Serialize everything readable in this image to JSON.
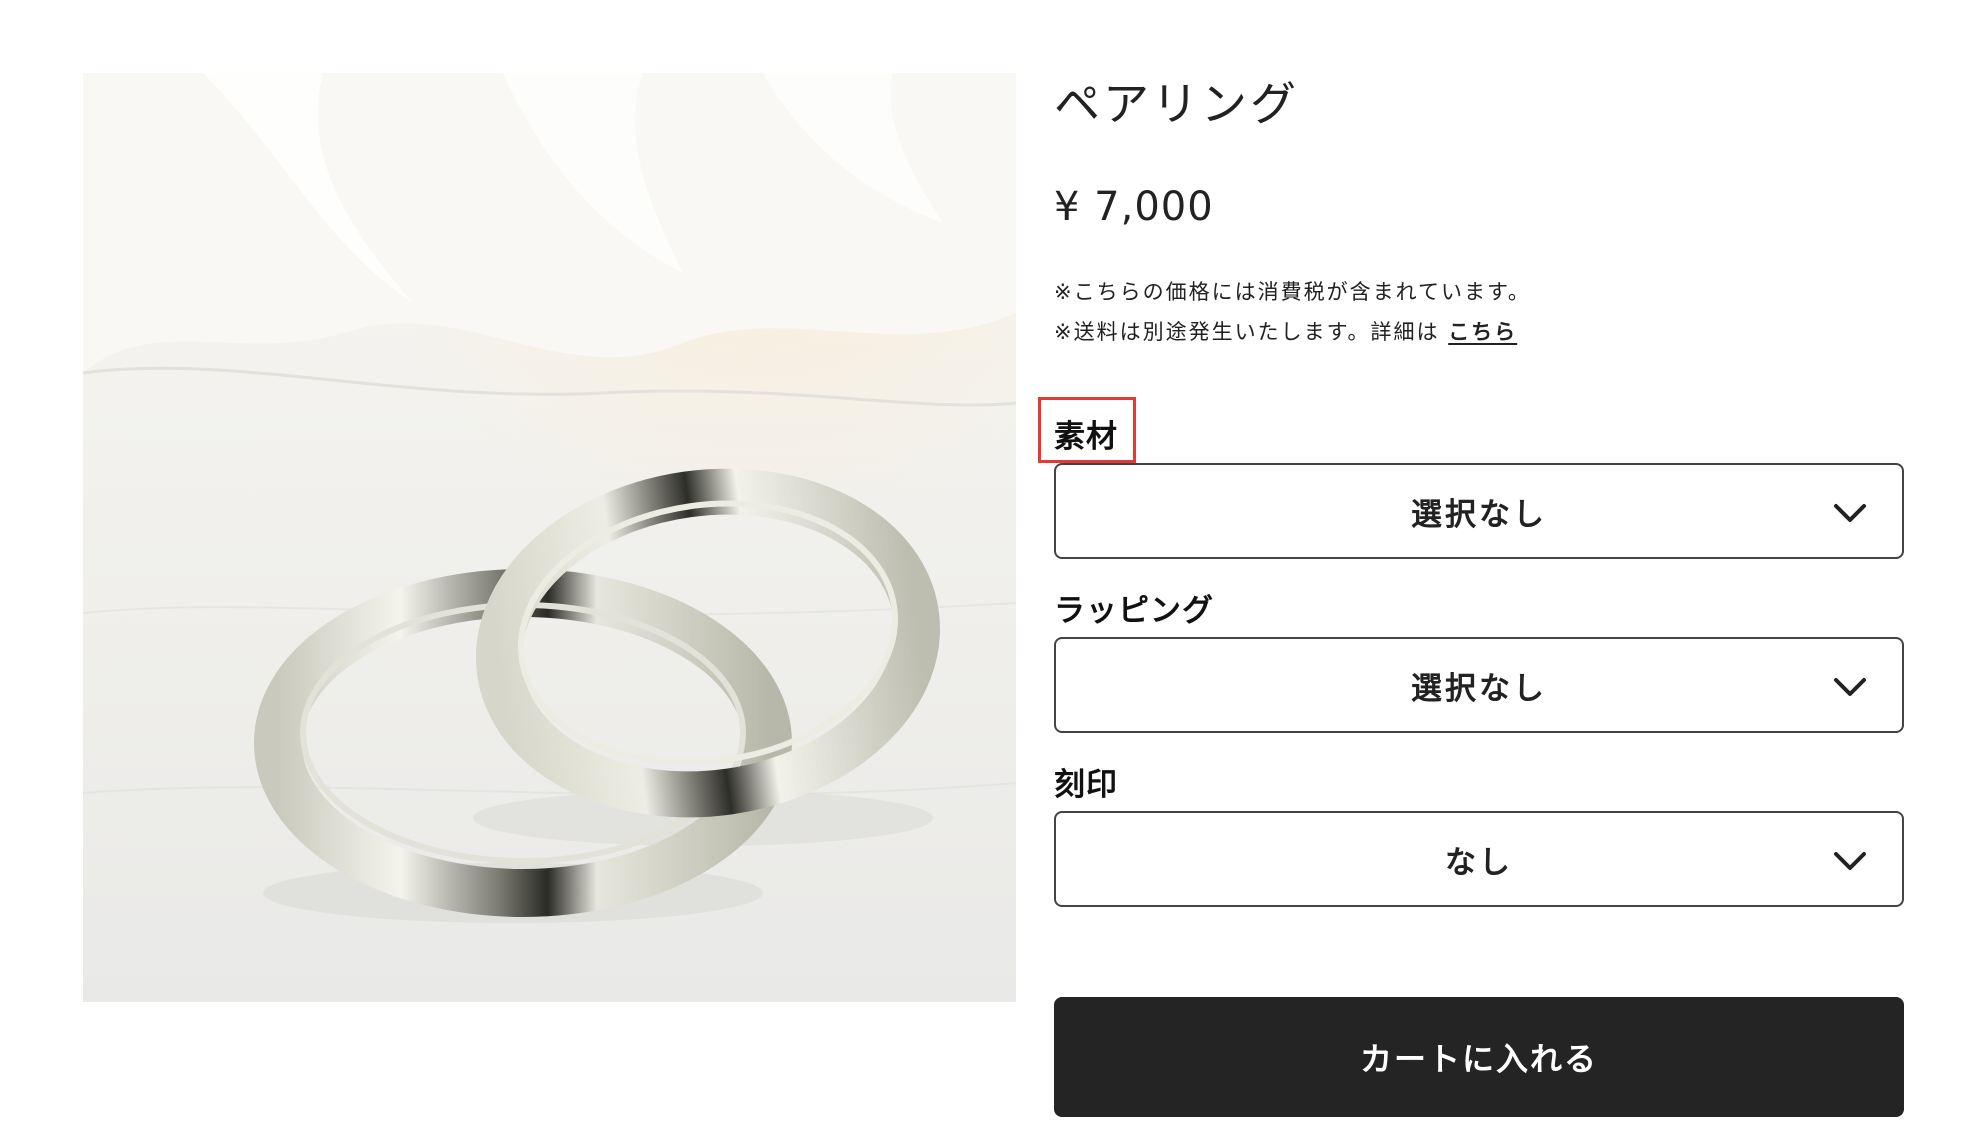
{
  "product": {
    "title": "ペアリング",
    "price": "¥ 7,000",
    "image_alt": "pair-rings-photo"
  },
  "notes": {
    "tax": "※こちらの価格には消費税が含まれています。",
    "shipping_prefix": "※送料は別途発生いたします。詳細は",
    "shipping_link": "こちら"
  },
  "options": [
    {
      "label": "素材",
      "value": "選択なし"
    },
    {
      "label": "ラッピング",
      "value": "選択なし"
    },
    {
      "label": "刻印",
      "value": "なし"
    }
  ],
  "cart": {
    "button_label": "カートに入れる"
  },
  "colors": {
    "highlight": "#e53935",
    "button_bg": "#242424",
    "border": "#444444"
  },
  "icons": {
    "dropdown": "chevron-down-icon"
  }
}
